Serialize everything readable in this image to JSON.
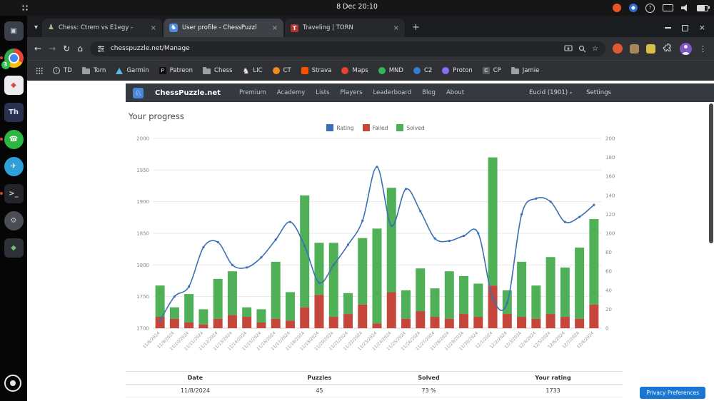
{
  "system_bar": {
    "clock": "8 Dec 20:10"
  },
  "icons": {
    "tab_search": "▾",
    "new_tab": "+",
    "back": "←",
    "forward": "→",
    "reload": "↻",
    "home": "⌂",
    "bookmark_star": "☆",
    "overflow_menu": "⋮",
    "window_close": "×",
    "tab_close": "×",
    "caret_down": "▾",
    "help": "?",
    "site_logo": "♘"
  },
  "dock": {
    "items": [
      {
        "name": "screenshot-tool-app",
        "kind": "tile",
        "bg": "#3a3f4a",
        "glyph": "▣",
        "fg": "#c9ced8"
      },
      {
        "name": "chrome-browser",
        "kind": "chrome",
        "badge": "3",
        "running": true
      },
      {
        "name": "extension-app",
        "kind": "tile",
        "bg": "#ececf0",
        "glyph": "◆",
        "fg": "#d84b3a"
      },
      {
        "name": "thunderbird-app",
        "kind": "tile",
        "bg": "#2a3150",
        "glyph": "Th",
        "fg": "#dfe6ff"
      },
      {
        "name": "whatsapp-app",
        "kind": "circle",
        "bg": "#2bb741",
        "glyph": "☎",
        "fg": "#ffffff",
        "running": true
      },
      {
        "name": "telegram-app",
        "kind": "circle",
        "bg": "#2f9fd8",
        "glyph": "✈",
        "fg": "#ffffff"
      },
      {
        "name": "terminal-app",
        "kind": "tile",
        "bg": "#23252a",
        "glyph": ">_",
        "fg": "#cfd4da",
        "running": true
      },
      {
        "name": "settings-app",
        "kind": "circle",
        "bg": "#4a4d55",
        "glyph": "⚙",
        "fg": "#b9bec7"
      },
      {
        "name": "software-center-app",
        "kind": "tile",
        "bg": "#2e3138",
        "glyph": "◆",
        "fg": "#6ec06e"
      },
      {
        "name": "show-apps",
        "kind": "ring",
        "bottom": true
      }
    ]
  },
  "browser": {
    "tabs": [
      {
        "title": "Chess: Ctrem vs E1egy -",
        "favicon": "pawn",
        "active": false
      },
      {
        "title": "User profile - ChessPuzzl",
        "favicon": "knight",
        "active": true
      },
      {
        "title": "Traveling | TORN",
        "favicon": "torn",
        "active": false
      }
    ],
    "favicon_glyphs": {
      "pawn": "♟",
      "knight": "♞",
      "torn": "T"
    },
    "url": "chesspuzzle.net/Manage",
    "bookmarks": [
      {
        "label": "TD",
        "icon": {
          "kind": "outline-circle",
          "glyph": "i",
          "name": "info-icon"
        }
      },
      {
        "label": "Torn",
        "icon": {
          "kind": "folder",
          "name": "folder-icon"
        }
      },
      {
        "label": "Garmin",
        "icon": {
          "kind": "triangle",
          "color": "#58b7e8",
          "name": "garmin-icon"
        }
      },
      {
        "label": "Patreon",
        "icon": {
          "kind": "square",
          "color": "#111111",
          "glyph": "P",
          "name": "patreon-icon"
        }
      },
      {
        "label": "Chess",
        "icon": {
          "kind": "folder",
          "name": "folder-icon"
        }
      },
      {
        "label": "LIC",
        "icon": {
          "kind": "glyph",
          "glyph": "♞",
          "fg": "#e8e8e8",
          "name": "lichess-icon"
        }
      },
      {
        "label": "CT",
        "icon": {
          "kind": "circle",
          "color": "#f08a24",
          "name": "chesstempo-icon"
        }
      },
      {
        "label": "Strava",
        "icon": {
          "kind": "square",
          "color": "#fc5200",
          "name": "strava-icon"
        }
      },
      {
        "label": "Maps",
        "icon": {
          "kind": "circle",
          "color": "#ea4335",
          "name": "maps-icon"
        }
      },
      {
        "label": "MND",
        "icon": {
          "kind": "circle",
          "color": "#35b558",
          "name": "mnd-icon"
        }
      },
      {
        "label": "C2",
        "icon": {
          "kind": "circle",
          "color": "#2f7fd0",
          "name": "c2-icon"
        }
      },
      {
        "label": "Proton",
        "icon": {
          "kind": "circle",
          "color": "#8a6df0",
          "name": "proton-icon"
        }
      },
      {
        "label": "CP",
        "icon": {
          "kind": "square",
          "color": "#5a5d66",
          "glyph": "C",
          "name": "cp-icon"
        }
      },
      {
        "label": "Jamie",
        "icon": {
          "kind": "folder",
          "name": "folder-icon"
        }
      }
    ]
  },
  "site": {
    "brand": "ChessPuzzle.net",
    "nav": [
      "Premium",
      "Academy",
      "Lists",
      "Players",
      "Leaderboard",
      "Blog",
      "About"
    ],
    "user_label": "Eucid (1901)",
    "settings_label": "Settings",
    "heading": "Your progress"
  },
  "chart_data": {
    "type": "bar_line_combo",
    "stacked_bars": true,
    "legend_position": "top",
    "grid": true,
    "x": [
      "11/8/2024",
      "11/9/2024",
      "11/10/2024",
      "11/11/2024",
      "11/12/2024",
      "11/13/2024",
      "11/14/2024",
      "11/15/2024",
      "11/16/2024",
      "11/17/2024",
      "11/18/2024",
      "11/19/2024",
      "11/20/2024",
      "11/21/2024",
      "11/22/2024",
      "11/23/2024",
      "11/24/2024",
      "11/25/2024",
      "11/26/2024",
      "11/27/2024",
      "11/28/2024",
      "11/29/2024",
      "11/30/2024",
      "12/1/2024",
      "12/2/2024",
      "12/3/2024",
      "12/4/2024",
      "12/5/2024",
      "12/6/2024",
      "12/7/2024",
      "12/8/2024"
    ],
    "series": [
      {
        "name": "Rating",
        "type": "line",
        "axis": "left",
        "color": "#3a6fb5",
        "values": [
          1712,
          1750,
          1766,
          1828,
          1836,
          1800,
          1796,
          1812,
          1840,
          1868,
          1830,
          1772,
          1800,
          1832,
          1870,
          1955,
          1862,
          1920,
          1885,
          1842,
          1838,
          1846,
          1850,
          1748,
          1740,
          1880,
          1905,
          1900,
          1868,
          1876,
          1895
        ]
      },
      {
        "name": "Failed",
        "type": "bar",
        "axis": "right",
        "color": "#c5473b",
        "values": [
          12,
          10,
          6,
          4,
          10,
          14,
          12,
          6,
          10,
          8,
          22,
          35,
          12,
          15,
          25,
          5,
          38,
          10,
          18,
          12,
          10,
          15,
          12,
          45,
          15,
          12,
          10,
          15,
          12,
          10,
          25
        ]
      },
      {
        "name": "Solved",
        "type": "bar",
        "axis": "right",
        "color": "#50b057",
        "values": [
          33,
          12,
          30,
          16,
          42,
          46,
          10,
          14,
          60,
          30,
          118,
          55,
          78,
          22,
          70,
          100,
          110,
          30,
          45,
          30,
          50,
          40,
          35,
          135,
          25,
          58,
          35,
          60,
          52,
          75,
          90
        ]
      }
    ],
    "left_axis": {
      "min": 1700,
      "max": 2000,
      "tick_step": 50
    },
    "right_axis": {
      "min": 0,
      "max": 200,
      "tick_step": 20
    }
  },
  "table": {
    "headers": [
      "Date",
      "Puzzles",
      "Solved",
      "Your rating"
    ],
    "rows": [
      [
        "11/8/2024",
        "45",
        "73 %",
        "1733"
      ]
    ]
  },
  "privacy": {
    "label": "Privacy Preferences"
  }
}
